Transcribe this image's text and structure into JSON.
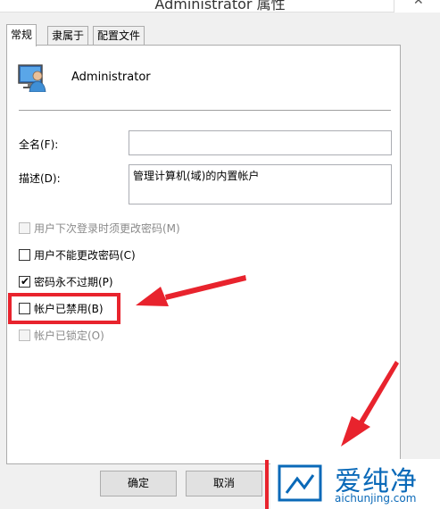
{
  "window": {
    "title": "Administrator 属性",
    "close_glyph": "✕"
  },
  "tabs": [
    {
      "label": "常规",
      "active": true
    },
    {
      "label": "隶属于",
      "active": false
    },
    {
      "label": "配置文件",
      "active": false
    }
  ],
  "user": {
    "name": "Administrator",
    "icon": "user-computer-icon"
  },
  "fields": {
    "full_name_label": "全名(F):",
    "full_name_value": "",
    "description_label": "描述(D):",
    "description_value": "管理计算机(域)的内置帐户"
  },
  "checkboxes": [
    {
      "label": "用户下次登录时须更改密码(M)",
      "checked": false,
      "disabled": true
    },
    {
      "label": "用户不能更改密码(C)",
      "checked": false,
      "disabled": false
    },
    {
      "label": "密码永不过期(P)",
      "checked": true,
      "disabled": false
    },
    {
      "label": "帐户已禁用(B)",
      "checked": false,
      "disabled": false
    },
    {
      "label": "帐户已锁定(O)",
      "checked": false,
      "disabled": true
    }
  ],
  "buttons": {
    "ok": "确定",
    "cancel": "取消"
  },
  "watermark": {
    "cn": "爱纯净",
    "en": "aichunjing.com"
  },
  "colors": {
    "annotation_red": "#e8232d",
    "watermark_blue": "#0a69b8"
  }
}
